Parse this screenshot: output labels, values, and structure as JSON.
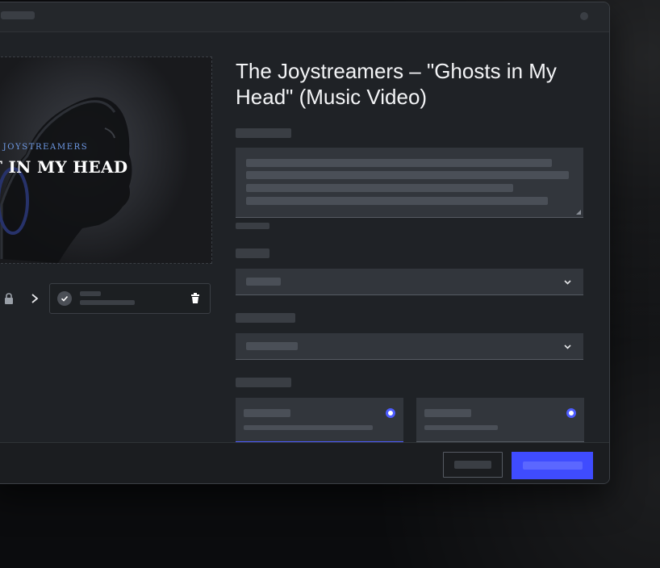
{
  "app": {
    "window_title": ""
  },
  "preview": {
    "band_name": "E JOYSTREAMERS",
    "song_title": "T IN MY HEAD"
  },
  "form": {
    "video_title": "The Joystreamers – \"Ghosts in My Head\" (Music Video)",
    "accent_color": "#3f4cff",
    "selected_option_index": 0
  },
  "icons": {
    "lock": "lock-icon",
    "next": "chevron-right-icon",
    "check": "check-icon",
    "trash": "trash-icon",
    "dropdown": "chevron-down-icon"
  }
}
